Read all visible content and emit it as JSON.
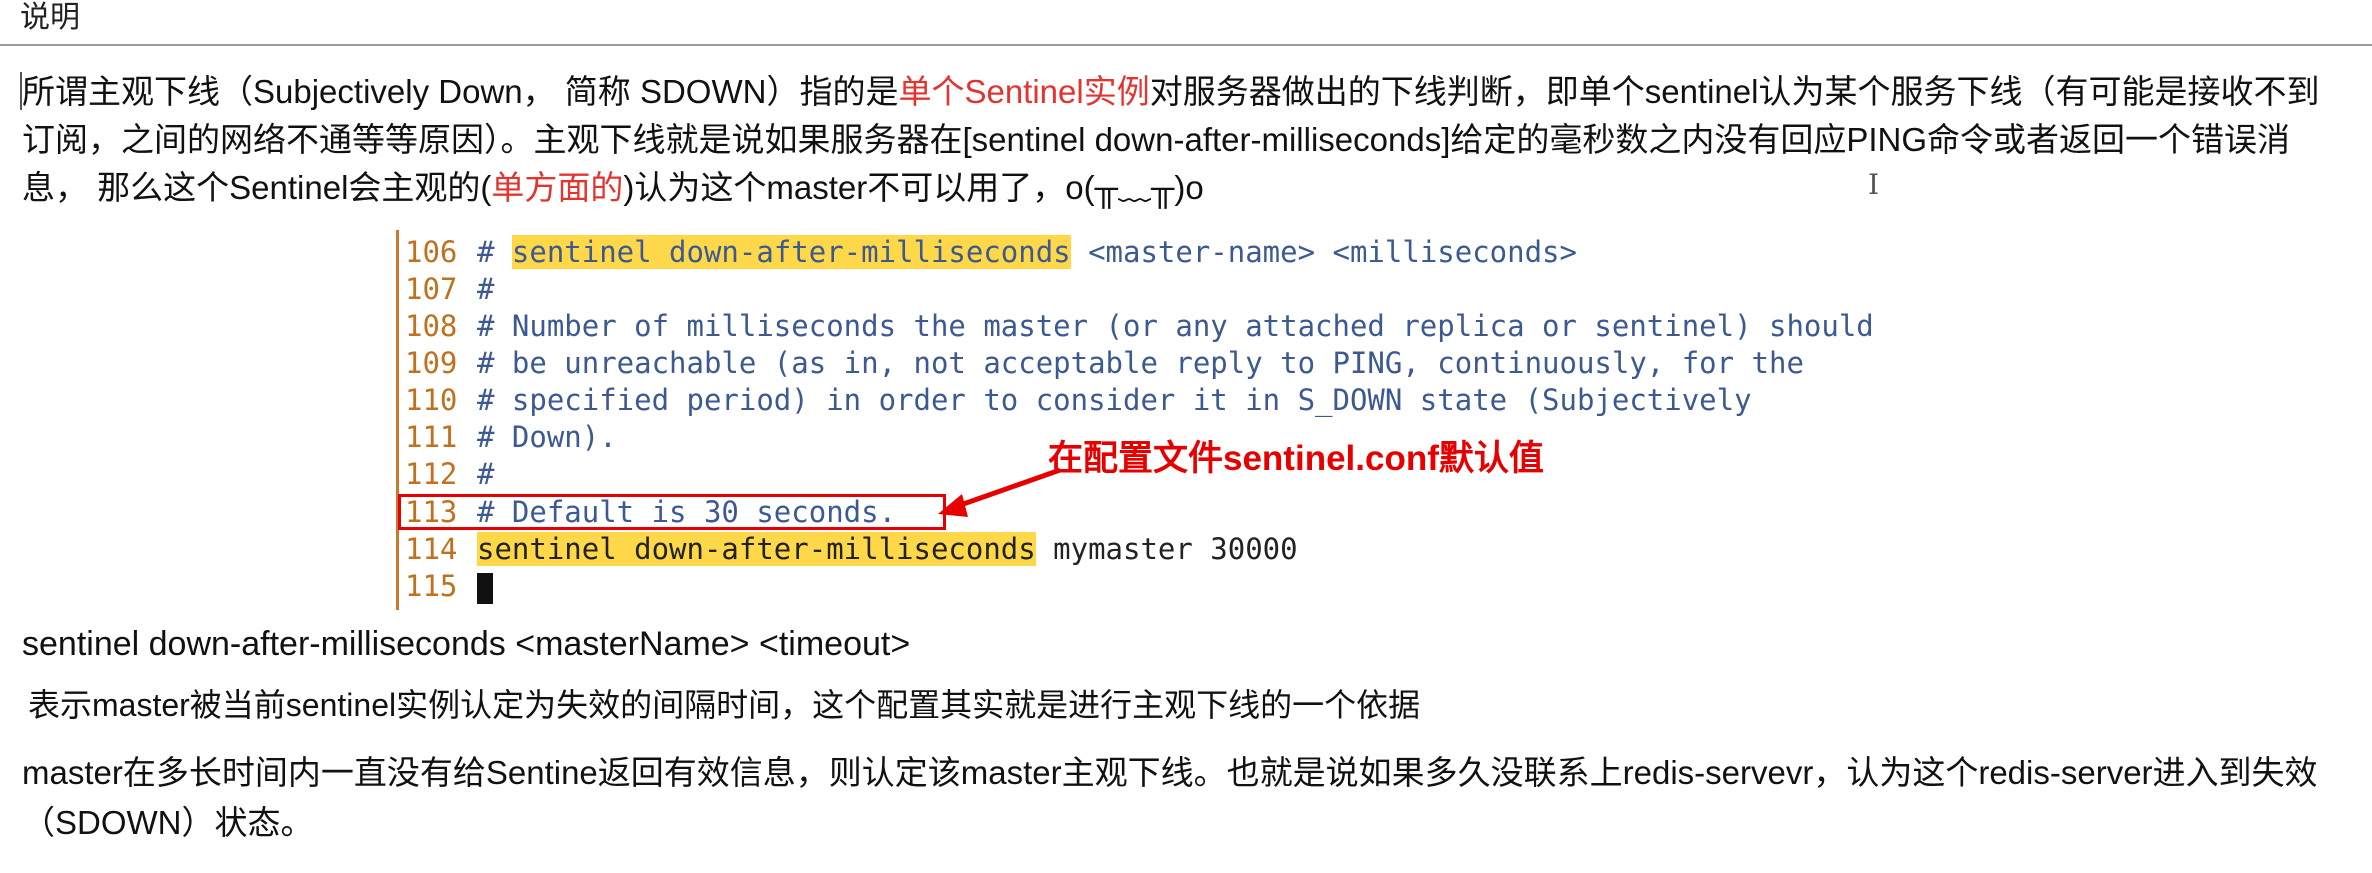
{
  "header": {
    "title": "说明"
  },
  "intro": {
    "seg1": "所谓主观下线（Subjectively Down， 简称 SDOWN）指的是",
    "seg2_red": "单个Sentinel实例",
    "seg3": "对服务器做出的下线判断，即单个sentinel认为某个服务下线（有可能是接收不到订阅，之间的网络不通等等原因）。主观下线就是说如果服务器在[sentinel down-after-milliseconds]给定的毫秒数之内没有回应PING命令或者返回一个错误消息， 那么这个Sentinel会主观的(",
    "seg4_red": "单方面的",
    "seg5": ")认为这个master不可以用了，o(╥﹏╥)o"
  },
  "code": {
    "lines": [
      {
        "num": "106",
        "hash": "# ",
        "highlight": "sentinel down-after-milliseconds",
        "rest": " <master-name> <milliseconds>"
      },
      {
        "num": "107",
        "text": "#"
      },
      {
        "num": "108",
        "text": "# Number of milliseconds the master (or any attached replica or sentinel) should"
      },
      {
        "num": "109",
        "text": "# be unreachable (as in, not acceptable reply to PING, continuously, for the"
      },
      {
        "num": "110",
        "text": "# specified period) in order to consider it in S_DOWN state (Subjectively"
      },
      {
        "num": "111",
        "text": "# Down)."
      },
      {
        "num": "112",
        "text": "#"
      },
      {
        "num": "113",
        "text": "# Default is 30 seconds."
      },
      {
        "num": "114",
        "highlight": "sentinel down-after-milliseconds",
        "rest": " mymaster 30000"
      },
      {
        "num": "115"
      }
    ]
  },
  "annotation": {
    "text": "在配置文件sentinel.conf默认值",
    "color": "#e60000"
  },
  "command": {
    "text": "sentinel down-after-milliseconds <masterName> <timeout>"
  },
  "description": {
    "line1": " 表示master被当前sentinel实例认定为失效的间隔时间，这个配置其实就是进行主观下线的一个依据",
    "line2": "master在多长时间内一直没有给Sentine返回有效信息，则认定该master主观下线。也就是说如果多久没联系上redis-servevr，认为这个redis-server进入到失效（SDOWN）状态。"
  },
  "colors": {
    "accent_red": "#e3342f",
    "highlight_yellow": "#ffd84a",
    "comment_blue": "#3c5a91",
    "line_number_orange": "#c0711f"
  }
}
